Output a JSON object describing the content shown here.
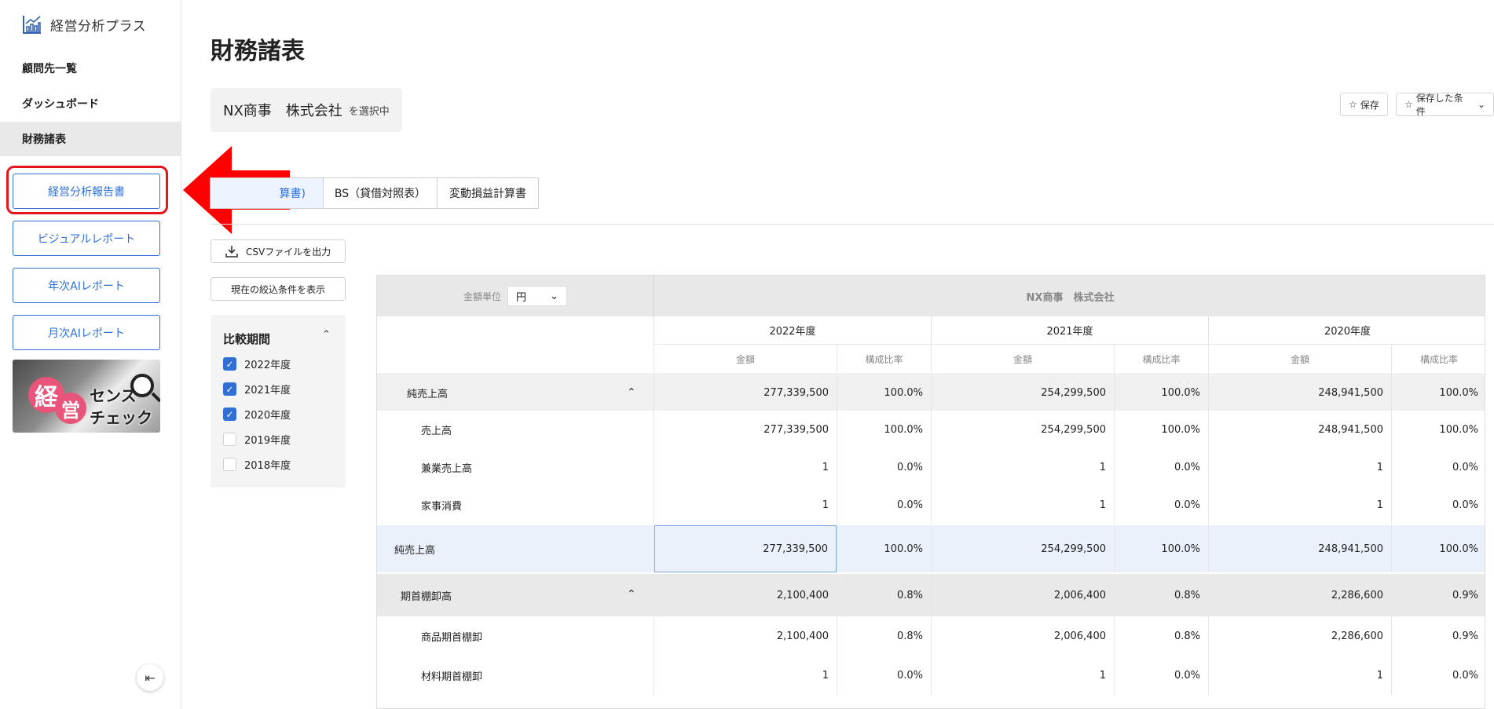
{
  "app": {
    "name": "経営分析プラス"
  },
  "sidebar": {
    "nav": [
      {
        "label": "顧問先一覧"
      },
      {
        "label": "ダッシュボード"
      },
      {
        "label": "財務諸表",
        "active": true
      }
    ],
    "buttons": [
      {
        "label": "経営分析報告書",
        "highlighted": true
      },
      {
        "label": "ビジュアルレポート"
      },
      {
        "label": "年次AIレポート"
      },
      {
        "label": "月次AIレポート"
      }
    ],
    "banner": {
      "char1": "経",
      "char2": "営",
      "line1": "センス",
      "line2": "チェック"
    }
  },
  "page": {
    "title": "財務諸表"
  },
  "company": {
    "name": "NX商事　株式会社",
    "suffix": "を選択中"
  },
  "actions": {
    "save": "保存",
    "saved_conditions": "保存した条件"
  },
  "tabs": [
    {
      "label": "算書)",
      "active": true
    },
    {
      "label": "BS（貸借対照表）"
    },
    {
      "label": "変動損益計算書"
    }
  ],
  "tools": {
    "csv": "CSVファイルを出力",
    "show_filters": "現在の絞込条件を表示"
  },
  "period": {
    "title": "比較期間",
    "items": [
      {
        "label": "2022年度",
        "checked": true
      },
      {
        "label": "2021年度",
        "checked": true
      },
      {
        "label": "2020年度",
        "checked": true
      },
      {
        "label": "2019年度",
        "checked": false
      },
      {
        "label": "2018年度",
        "checked": false
      }
    ]
  },
  "table": {
    "unit_label": "金額単位",
    "unit_value": "円",
    "company_header": "NX商事　株式会社",
    "years": [
      "2022年度",
      "2021年度",
      "2020年度"
    ],
    "sub_headers": {
      "amount": "金額",
      "ratio": "構成比率"
    },
    "rows": [
      {
        "label": "純売上高",
        "values": [
          "277,339,500",
          "100.0%",
          "254,299,500",
          "100.0%",
          "248,941,500",
          "100.0%"
        ]
      },
      {
        "label": "売上高",
        "values": [
          "277,339,500",
          "100.0%",
          "254,299,500",
          "100.0%",
          "248,941,500",
          "100.0%"
        ]
      },
      {
        "label": "兼業売上高",
        "values": [
          "1",
          "0.0%",
          "1",
          "0.0%",
          "1",
          "0.0%"
        ]
      },
      {
        "label": "家事消費",
        "values": [
          "1",
          "0.0%",
          "1",
          "0.0%",
          "1",
          "0.0%"
        ]
      },
      {
        "label": "純売上高",
        "values": [
          "277,339,500",
          "100.0%",
          "254,299,500",
          "100.0%",
          "248,941,500",
          "100.0%"
        ]
      },
      {
        "label": "期首棚卸高",
        "values": [
          "2,100,400",
          "0.8%",
          "2,006,400",
          "0.8%",
          "2,286,600",
          "0.9%"
        ]
      },
      {
        "label": "商品期首棚卸",
        "values": [
          "2,100,400",
          "0.8%",
          "2,006,400",
          "0.8%",
          "2,286,600",
          "0.9%"
        ]
      },
      {
        "label": "材料期首棚卸",
        "values": [
          "1",
          "0.0%",
          "1",
          "0.0%",
          "1",
          "0.0%"
        ]
      }
    ]
  },
  "colors": {
    "accent": "#2f6fd6",
    "highlight": "#e3161b",
    "arrow": "#ff0000"
  }
}
